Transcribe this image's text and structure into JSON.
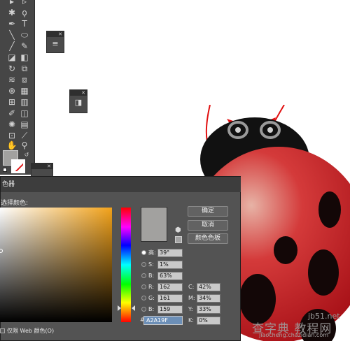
{
  "picker": {
    "title_fragment": "色器",
    "prompt": "选择颜色:",
    "buttons": {
      "ok": "确定",
      "cancel": "取消",
      "swatches": "颜色色板"
    },
    "fields": {
      "H": {
        "label": "高:",
        "value": "39°"
      },
      "S": {
        "label": "S:",
        "value": "1%"
      },
      "B": {
        "label": "B:",
        "value": "63%"
      },
      "R": {
        "label": "R:",
        "value": "162"
      },
      "G": {
        "label": "G:",
        "value": "161"
      },
      "Bl": {
        "label": "B:",
        "value": "159"
      },
      "C": {
        "label": "C:",
        "value": "42%"
      },
      "M": {
        "label": "M:",
        "value": "34%"
      },
      "Y": {
        "label": "Y:",
        "value": "33%"
      },
      "K": {
        "label": "K:",
        "value": "0%"
      }
    },
    "hex": {
      "label": "#",
      "value": "A2A19F"
    },
    "websafe_label": "仅限 Web 颜色(O)",
    "current_color": "#a2a19f"
  },
  "watermark": {
    "top": "jb51.net",
    "mid": "查字典 教程网",
    "bot": "jiaocheng.chazidian.com"
  }
}
